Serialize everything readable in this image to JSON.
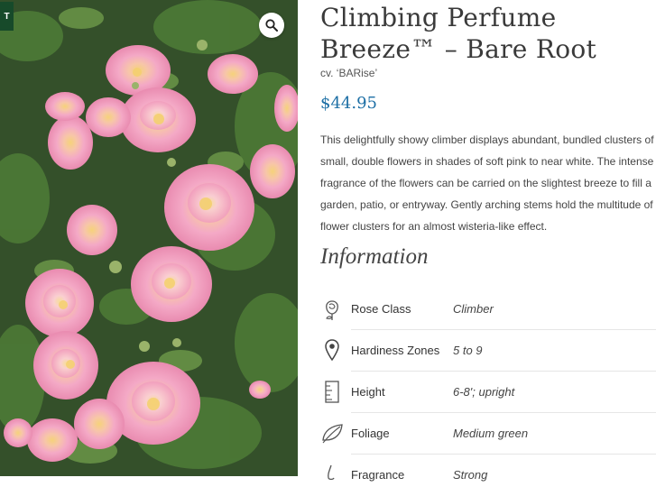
{
  "badge": "T",
  "product": {
    "title_line1": "Climbing Perfume",
    "title_line2": "Breeze™ – Bare Root",
    "cultivar": "cv. ‘BARise’",
    "price": "$44.95",
    "description_lines": [
      "This delightfully showy climber displays abundant, bundled clusters of",
      "small, double flowers in shades of soft pink to near white. The intense",
      "fragrance of the flowers can be carried on the slightest breeze to fill a",
      "garden, patio, or entryway. Gently arching stems hold the multitude of",
      "flower clusters for an almost wisteria-like effect."
    ]
  },
  "information": {
    "heading": "Information",
    "rows": [
      {
        "icon": "rose-icon",
        "label": "Rose Class",
        "value": "Climber"
      },
      {
        "icon": "map-pin-icon",
        "label": "Hardiness Zones",
        "value": "5 to 9"
      },
      {
        "icon": "height-icon",
        "label": "Height",
        "value": "6-8'; upright"
      },
      {
        "icon": "leaf-icon",
        "label": "Foliage",
        "value": "Medium green"
      },
      {
        "icon": "nose-icon",
        "label": "Fragrance",
        "value": "Strong"
      }
    ]
  },
  "colors": {
    "price": "#1d6fa5",
    "badge": "#174a2a",
    "petal_pink": "#f2a7c3",
    "foliage": "#3e5a2c"
  }
}
